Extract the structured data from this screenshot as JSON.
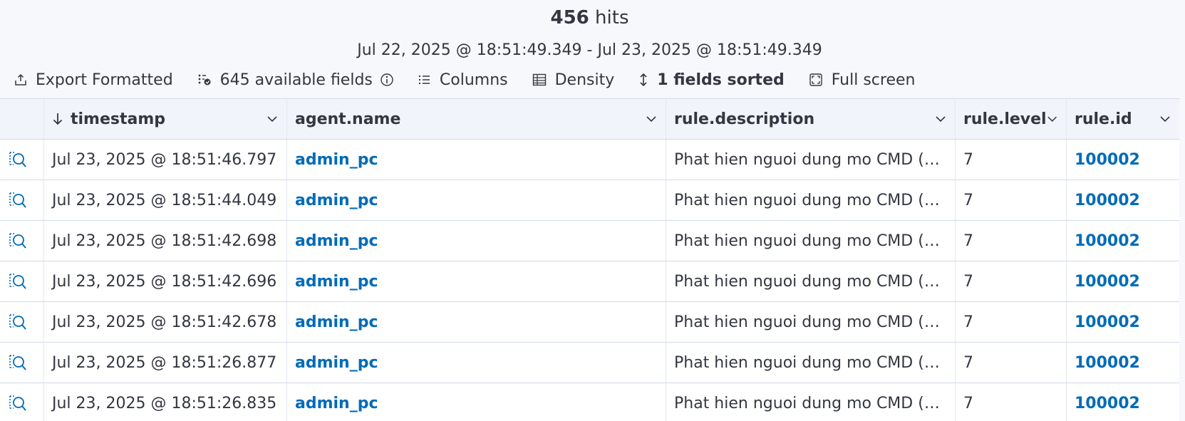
{
  "summary": {
    "hits_count": "456",
    "hits_label": "hits",
    "time_range": "Jul 22, 2025 @ 18:51:49.349 - Jul 23, 2025 @ 18:51:49.349"
  },
  "toolbar": {
    "export_label": "Export Formatted",
    "fields_label": "645 available fields",
    "columns_label": "Columns",
    "density_label": "Density",
    "sorted_label": "1 fields sorted",
    "fullscreen_label": "Full screen"
  },
  "columns": [
    {
      "label": "timestamp",
      "icon": "sort-arrow-down-icon"
    },
    {
      "label": "agent.name"
    },
    {
      "label": "rule.description"
    },
    {
      "label": "rule.level"
    },
    {
      "label": "rule.id"
    }
  ],
  "rows": [
    {
      "timestamp": "Jul 23, 2025 @ 18:51:46.797",
      "agent": "admin_pc",
      "description": "Phat hien nguoi dung mo CMD (c...",
      "level": "7",
      "id": "100002"
    },
    {
      "timestamp": "Jul 23, 2025 @ 18:51:44.049",
      "agent": "admin_pc",
      "description": "Phat hien nguoi dung mo CMD (c...",
      "level": "7",
      "id": "100002"
    },
    {
      "timestamp": "Jul 23, 2025 @ 18:51:42.698",
      "agent": "admin_pc",
      "description": "Phat hien nguoi dung mo CMD (c...",
      "level": "7",
      "id": "100002"
    },
    {
      "timestamp": "Jul 23, 2025 @ 18:51:42.696",
      "agent": "admin_pc",
      "description": "Phat hien nguoi dung mo CMD (c...",
      "level": "7",
      "id": "100002"
    },
    {
      "timestamp": "Jul 23, 2025 @ 18:51:42.678",
      "agent": "admin_pc",
      "description": "Phat hien nguoi dung mo CMD (c...",
      "level": "7",
      "id": "100002"
    },
    {
      "timestamp": "Jul 23, 2025 @ 18:51:26.877",
      "agent": "admin_pc",
      "description": "Phat hien nguoi dung mo CMD (c...",
      "level": "7",
      "id": "100002"
    },
    {
      "timestamp": "Jul 23, 2025 @ 18:51:26.835",
      "agent": "admin_pc",
      "description": "Phat hien nguoi dung mo CMD (c...",
      "level": "7",
      "id": "100002"
    }
  ],
  "colors": {
    "link": "#006bb8",
    "text": "#343741",
    "border": "#d3dae6",
    "header_bg": "#f1f4fa"
  }
}
